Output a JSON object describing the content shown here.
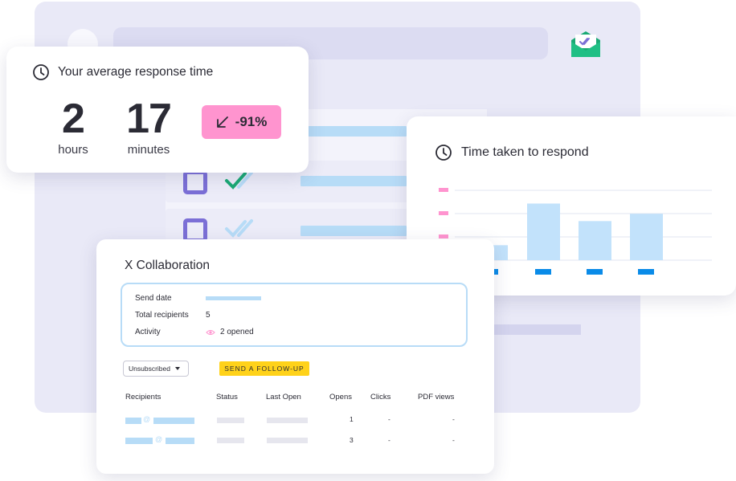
{
  "response_time_card": {
    "title": "Your average response time",
    "hours_value": "2",
    "hours_unit": "hours",
    "minutes_value": "17",
    "minutes_unit": "minutes",
    "change": "-91%",
    "change_color": "#ff94cf"
  },
  "time_chart_card": {
    "title": "Time taken to respond"
  },
  "chart_data": {
    "type": "bar",
    "title": "Time taken to respond",
    "series": [
      {
        "values": [
          0.15,
          0.72,
          0.48,
          0.58
        ]
      }
    ],
    "colors": {
      "bars": "#c2e2fb",
      "ticks": "#0a8be8",
      "y_markers": "#ff94cf"
    },
    "grid": true
  },
  "collaboration_card": {
    "title": "X Collaboration",
    "details": {
      "send_date_label": "Send date",
      "total_recipients_label": "Total recipients",
      "total_recipients_value": "5",
      "activity_label": "Activity",
      "activity_value": "2 opened"
    },
    "filter_select": "Unsubscribed",
    "follow_up_button": "SEND A FOLLOW-UP",
    "columns": [
      "Recipients",
      "Status",
      "Last Open",
      "Opens",
      "Clicks",
      "PDF views"
    ],
    "rows": [
      {
        "opens": "1",
        "clicks": "-",
        "pdf_views": "-"
      },
      {
        "opens": "3",
        "clicks": "-",
        "pdf_views": "-"
      }
    ]
  },
  "colors": {
    "accent_purple": "#7b6fd6",
    "accent_green": "#19a974",
    "accent_yellow": "#ffd21a",
    "light_blue": "#b7dcf7"
  }
}
